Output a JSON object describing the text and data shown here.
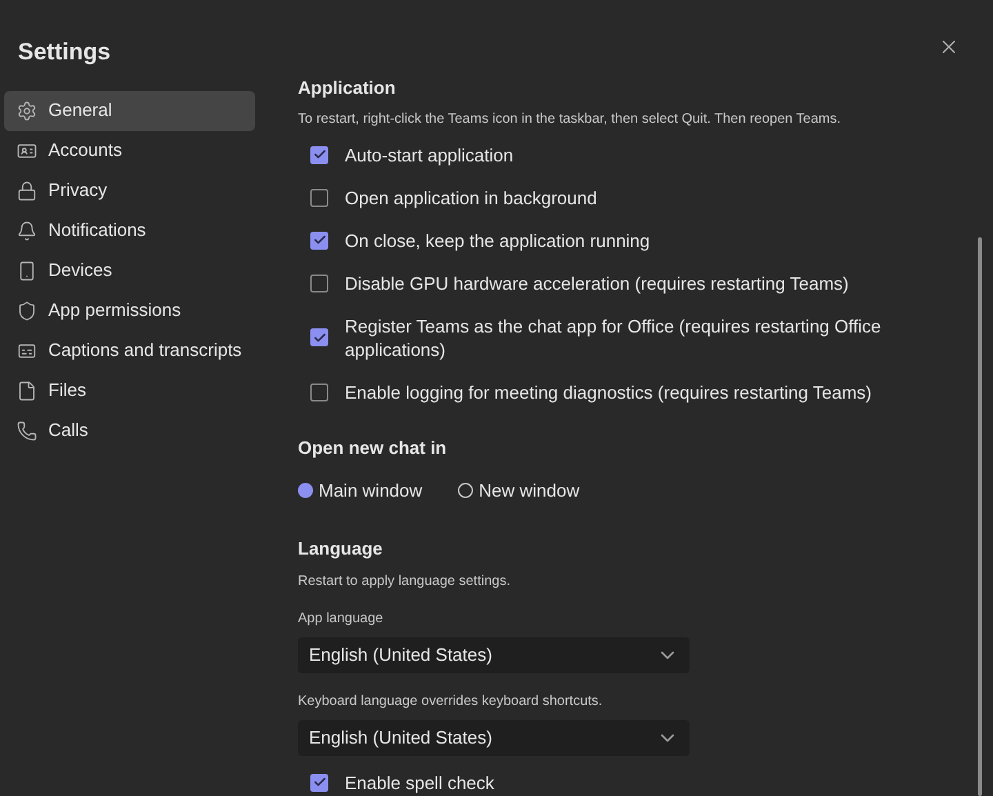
{
  "window": {
    "title": "Settings"
  },
  "sidebar": {
    "items": [
      {
        "label": "General",
        "selected": true
      },
      {
        "label": "Accounts",
        "selected": false
      },
      {
        "label": "Privacy",
        "selected": false
      },
      {
        "label": "Notifications",
        "selected": false
      },
      {
        "label": "Devices",
        "selected": false
      },
      {
        "label": "App permissions",
        "selected": false
      },
      {
        "label": "Captions and transcripts",
        "selected": false
      },
      {
        "label": "Files",
        "selected": false
      },
      {
        "label": "Calls",
        "selected": false
      }
    ]
  },
  "application": {
    "heading": "Application",
    "note": "To restart, right-click the Teams icon in the taskbar, then select Quit. Then reopen Teams.",
    "options": [
      {
        "label": "Auto-start application",
        "checked": true
      },
      {
        "label": "Open application in background",
        "checked": false
      },
      {
        "label": "On close, keep the application running",
        "checked": true
      },
      {
        "label": "Disable GPU hardware acceleration (requires restarting Teams)",
        "checked": false
      },
      {
        "label": "Register Teams as the chat app for Office (requires restarting Office applications)",
        "checked": true
      },
      {
        "label": "Enable logging for meeting diagnostics (requires restarting Teams)",
        "checked": false
      }
    ]
  },
  "open_new_chat_in": {
    "heading": "Open new chat in",
    "options": [
      {
        "label": "Main window",
        "selected": true
      },
      {
        "label": "New window",
        "selected": false
      }
    ]
  },
  "language": {
    "heading": "Language",
    "note": "Restart to apply language settings.",
    "app_language": {
      "label": "App language",
      "value": "English (United States)"
    },
    "keyboard_language": {
      "label": "Keyboard language overrides keyboard shortcuts.",
      "value": "English (United States)"
    },
    "spell_check": {
      "label": "Enable spell check",
      "checked": true
    }
  }
}
